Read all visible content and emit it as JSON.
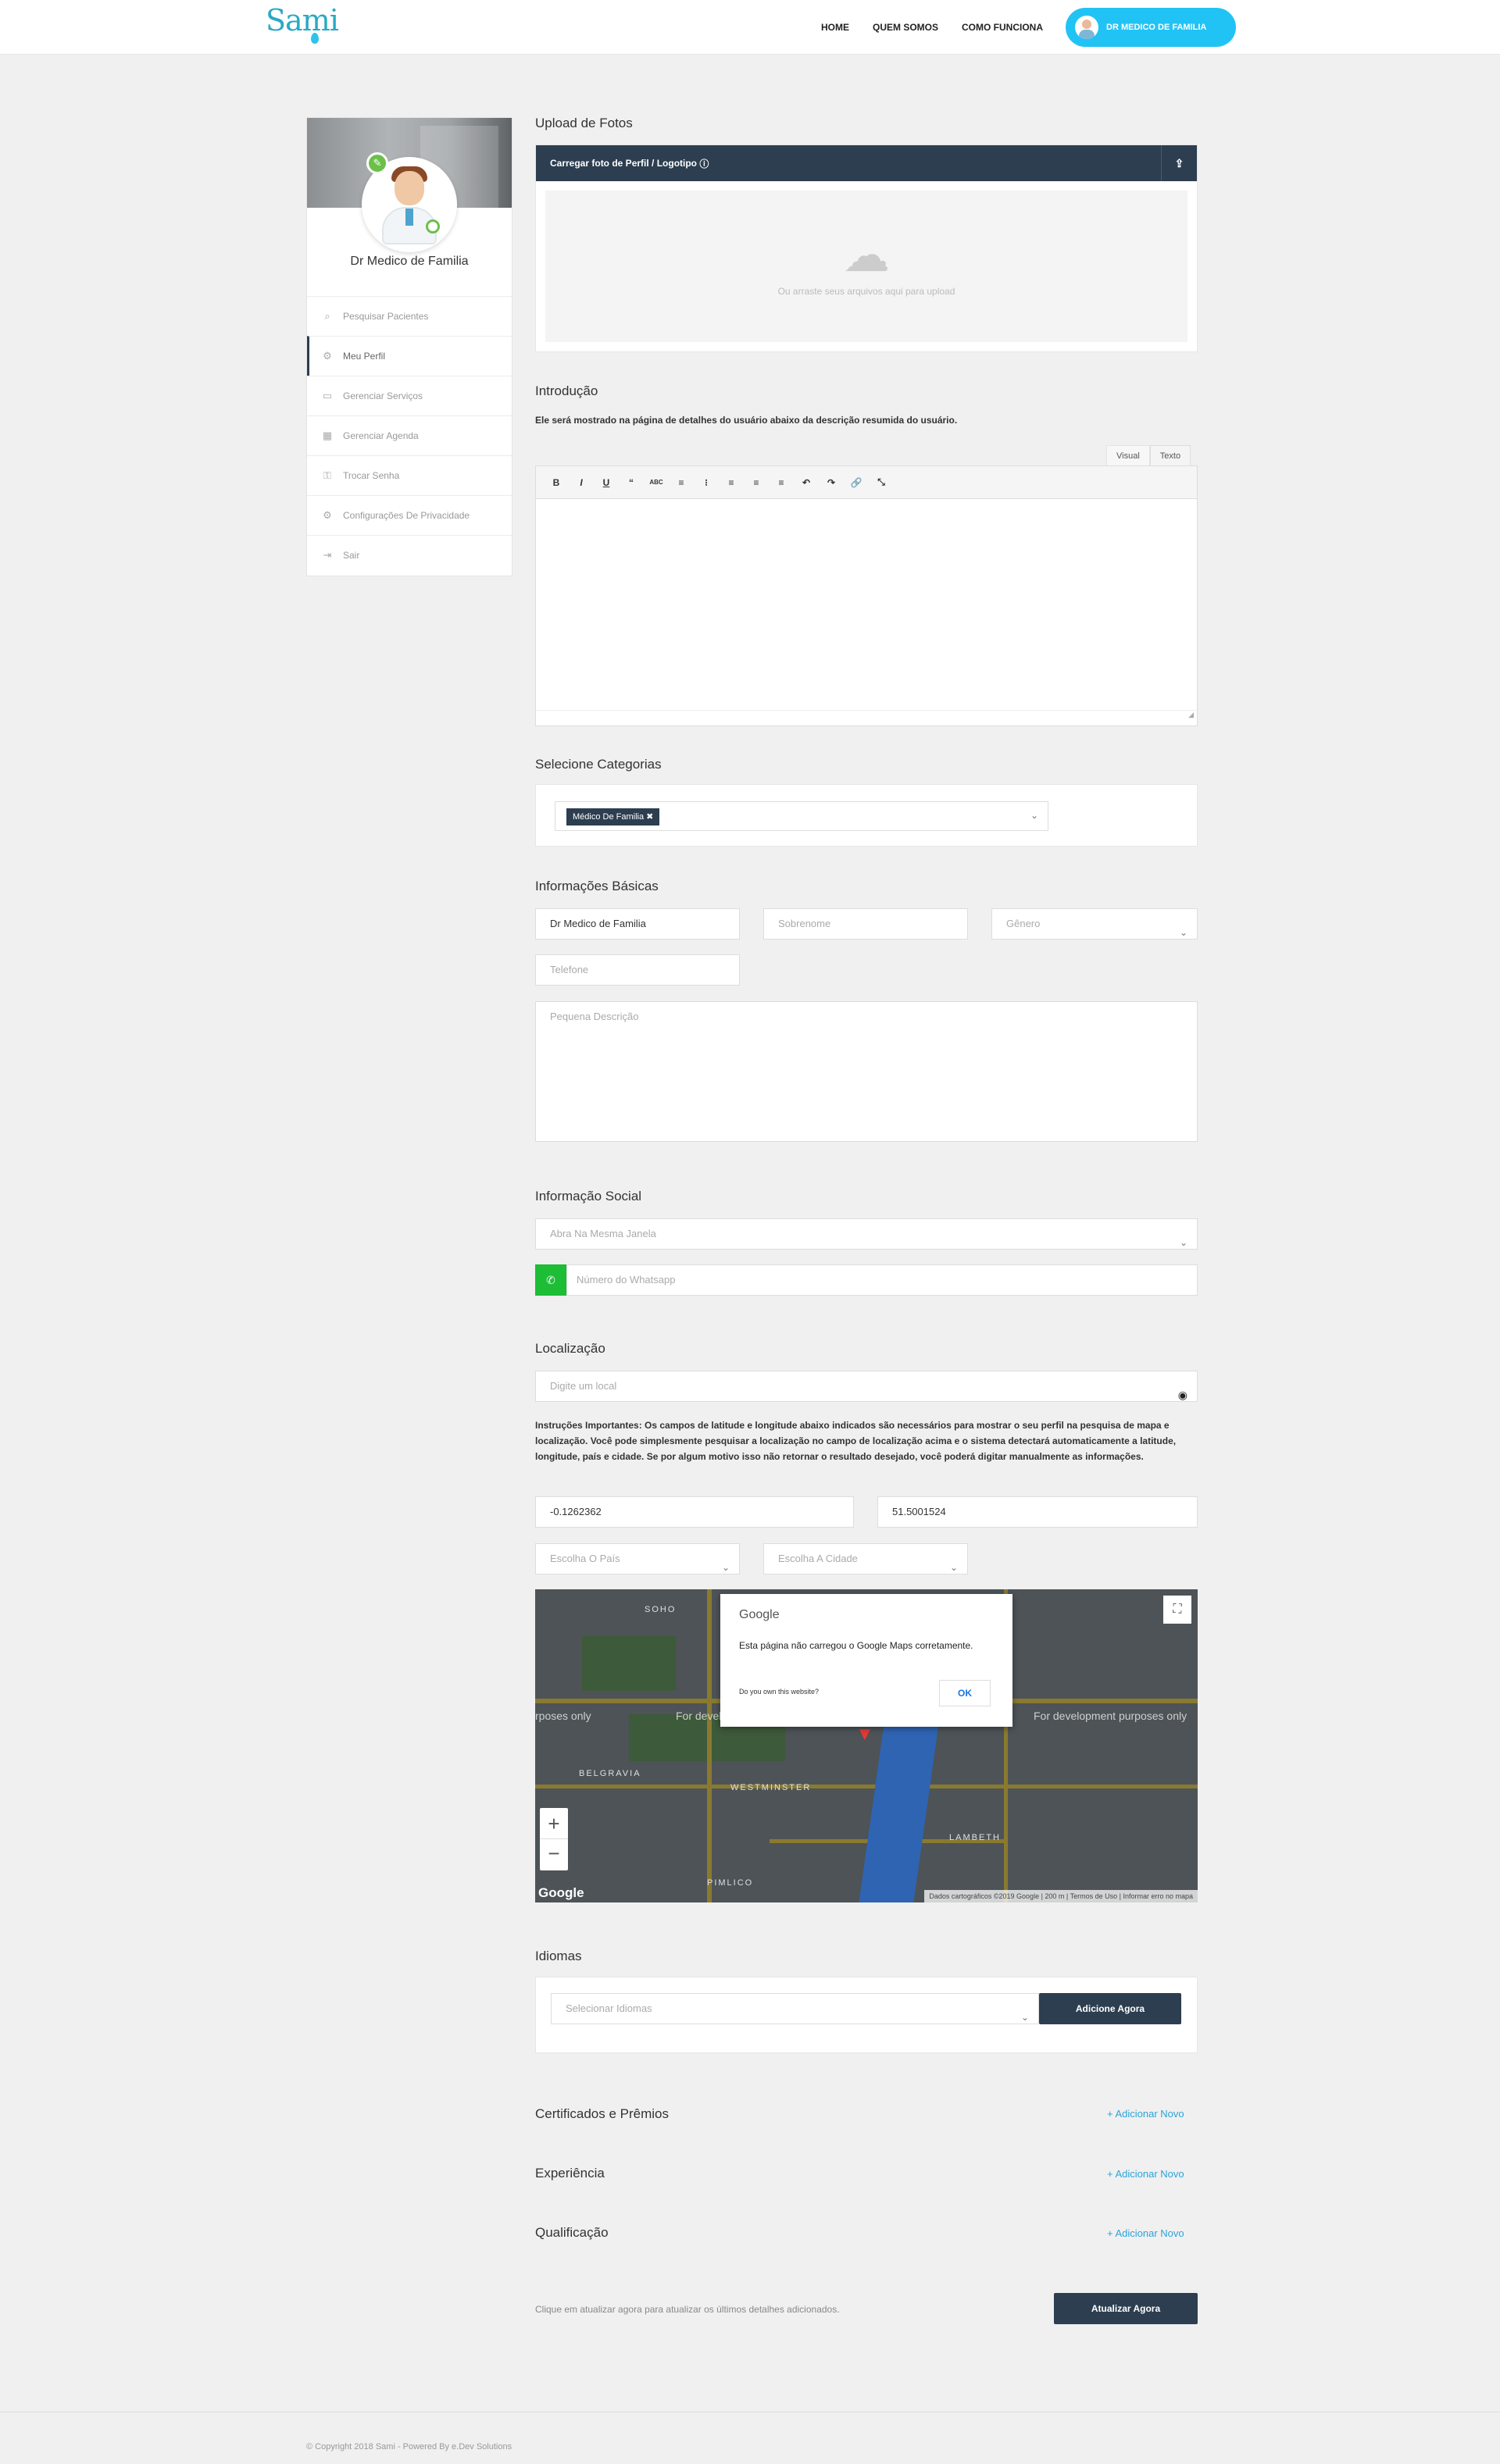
{
  "header": {
    "logo": "Sami",
    "nav": [
      "HOME",
      "QUEM SOMOS",
      "COMO FUNCIONA"
    ],
    "user_button": "DR MEDICO DE FAMILIA"
  },
  "sidebar": {
    "name": "Dr Medico de Familia",
    "items": [
      {
        "label": "Pesquisar Pacientes",
        "icon": "search-icon"
      },
      {
        "label": "Meu Perfil",
        "icon": "gear-icon",
        "active": true
      },
      {
        "label": "Gerenciar Serviços",
        "icon": "briefcase-icon"
      },
      {
        "label": "Gerenciar Agenda",
        "icon": "calendar-icon"
      },
      {
        "label": "Trocar Senha",
        "icon": "key-icon"
      },
      {
        "label": "Configurações De Privacidade",
        "icon": "settings-icon"
      },
      {
        "label": "Sair",
        "icon": "logout-icon"
      }
    ]
  },
  "upload": {
    "title": "Upload de Fotos",
    "header": "Carregar foto de Perfil / Logotipo",
    "hint": "Ou arraste seus arquivos aqui para upload"
  },
  "intro": {
    "title": "Introdução",
    "note": "Ele será mostrado na página de detalhes do usuário abaixo da descrição resumida do usuário.",
    "tab_visual": "Visual",
    "tab_text": "Texto",
    "toolbar": [
      "B",
      "I",
      "U",
      "“",
      "ABC",
      "≡",
      "⁝",
      "≡",
      "≡",
      "≡",
      "↶",
      "↷",
      "🔗",
      "⤡"
    ]
  },
  "categories": {
    "title": "Selecione Categorias",
    "selected": "Médico De Familia"
  },
  "basic": {
    "title": "Informações Básicas",
    "first_name": "Dr Medico de Familia",
    "last_name_placeholder": "Sobrenome",
    "gender_placeholder": "Gênero",
    "phone_placeholder": "Telefone",
    "description_placeholder": "Pequena Descrição"
  },
  "social": {
    "title": "Informação Social",
    "window_select": "Abra Na Mesma Janela",
    "whatsapp_placeholder": "Número do Whatsapp"
  },
  "location": {
    "title": "Localização",
    "search_placeholder": "Digite um local",
    "instructions": "Instruções Importantes: Os campos de latitude e longitude abaixo indicados são necessários para mostrar o seu perfil na pesquisa de mapa e localização. Você pode simplesmente pesquisar a localização no campo de localização acima e o sistema detectará automaticamente a latitude, longitude, país e cidade. Se por algum motivo isso não retornar o resultado desejado, você poderá digitar manualmente as informações.",
    "longitude": "-0.1262362",
    "latitude": "51.5001524",
    "country_placeholder": "Escolha O País",
    "city_placeholder": "Escolha A Cidade"
  },
  "map": {
    "dialog_brand": "Google",
    "dialog_message": "Esta página não carregou o Google Maps corretamente.",
    "dialog_link": "Do you own this website?",
    "dialog_ok": "OK",
    "dev_text": "For development purposes only",
    "dev_text_left": "rposes only",
    "labels": [
      "BELGRAVIA",
      "WESTMINSTER",
      "LAMBETH",
      "PIMLICO",
      "SOHO"
    ],
    "footer": "Dados cartográficos ©2019 Google | 200 m | Termos de Uso | Informar erro no mapa",
    "logo": "Google"
  },
  "languages": {
    "title": "Idiomas",
    "select_placeholder": "Selecionar Idiomas",
    "add_button": "Adicione Agora"
  },
  "sections": {
    "certificates": "Certificados e Prêmios",
    "experience": "Experiência",
    "qualification": "Qualificação",
    "add_new": "+ Adicionar Novo"
  },
  "update": {
    "note": "Clique em atualizar agora para atualizar os últimos detalhes adicionados.",
    "button": "Atualizar Agora"
  },
  "footer": {
    "copyright": "© Copyright 2018 Sami - Powered By e.Dev Solutions"
  }
}
